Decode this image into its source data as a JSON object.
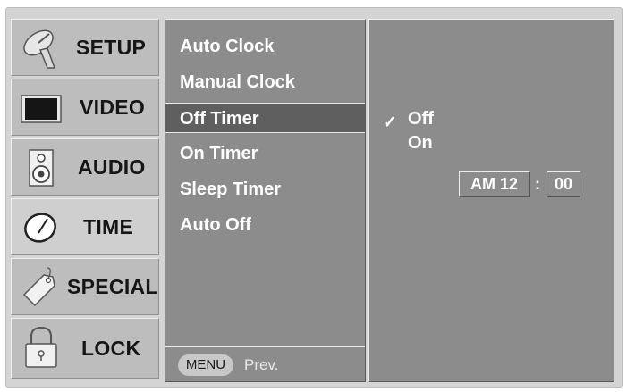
{
  "categories": [
    {
      "label": "SETUP",
      "icon": "satellite-dish-icon"
    },
    {
      "label": "VIDEO",
      "icon": "tv-screen-icon"
    },
    {
      "label": "AUDIO",
      "icon": "speaker-icon"
    },
    {
      "label": "TIME",
      "icon": "clock-icon"
    },
    {
      "label": "SPECIAL",
      "icon": "tag-icon"
    },
    {
      "label": "LOCK",
      "icon": "padlock-icon"
    }
  ],
  "active_category": "TIME",
  "items": [
    "Auto Clock",
    "Manual Clock",
    "Off Timer",
    "On Timer",
    "Sleep Timer",
    "Auto Off"
  ],
  "selected_item": "Off Timer",
  "options": [
    "Off",
    "On"
  ],
  "checked_option": "Off",
  "check_mark": "✓",
  "time": {
    "ampm_hour": "AM 12",
    "separator": ":",
    "minute": "00"
  },
  "menu": {
    "key": "MENU",
    "action": "Prev."
  }
}
